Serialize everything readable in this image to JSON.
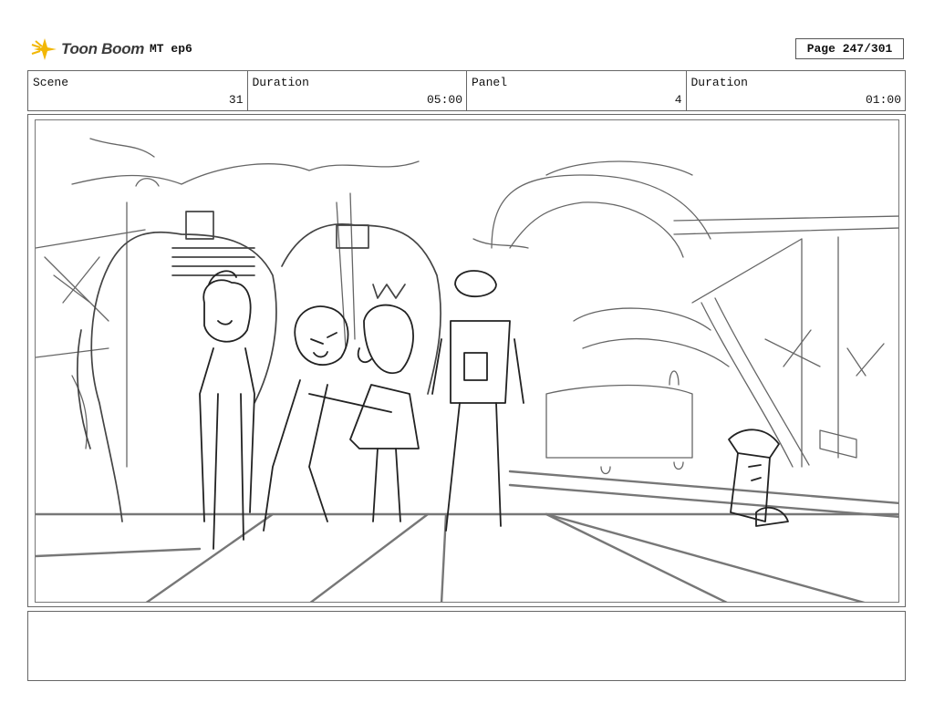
{
  "header": {
    "logo_text": "Toon Boom",
    "project": "MT ep6",
    "page": "Page 247/301"
  },
  "info": [
    {
      "label": "Scene",
      "value": "31"
    },
    {
      "label": "Duration",
      "value": "05:00"
    },
    {
      "label": "Panel",
      "value": "4"
    },
    {
      "label": "Duration",
      "value": "01:00"
    }
  ],
  "notes": "",
  "colors": {
    "logo_accent": "#f2b705",
    "line": "#555555"
  }
}
